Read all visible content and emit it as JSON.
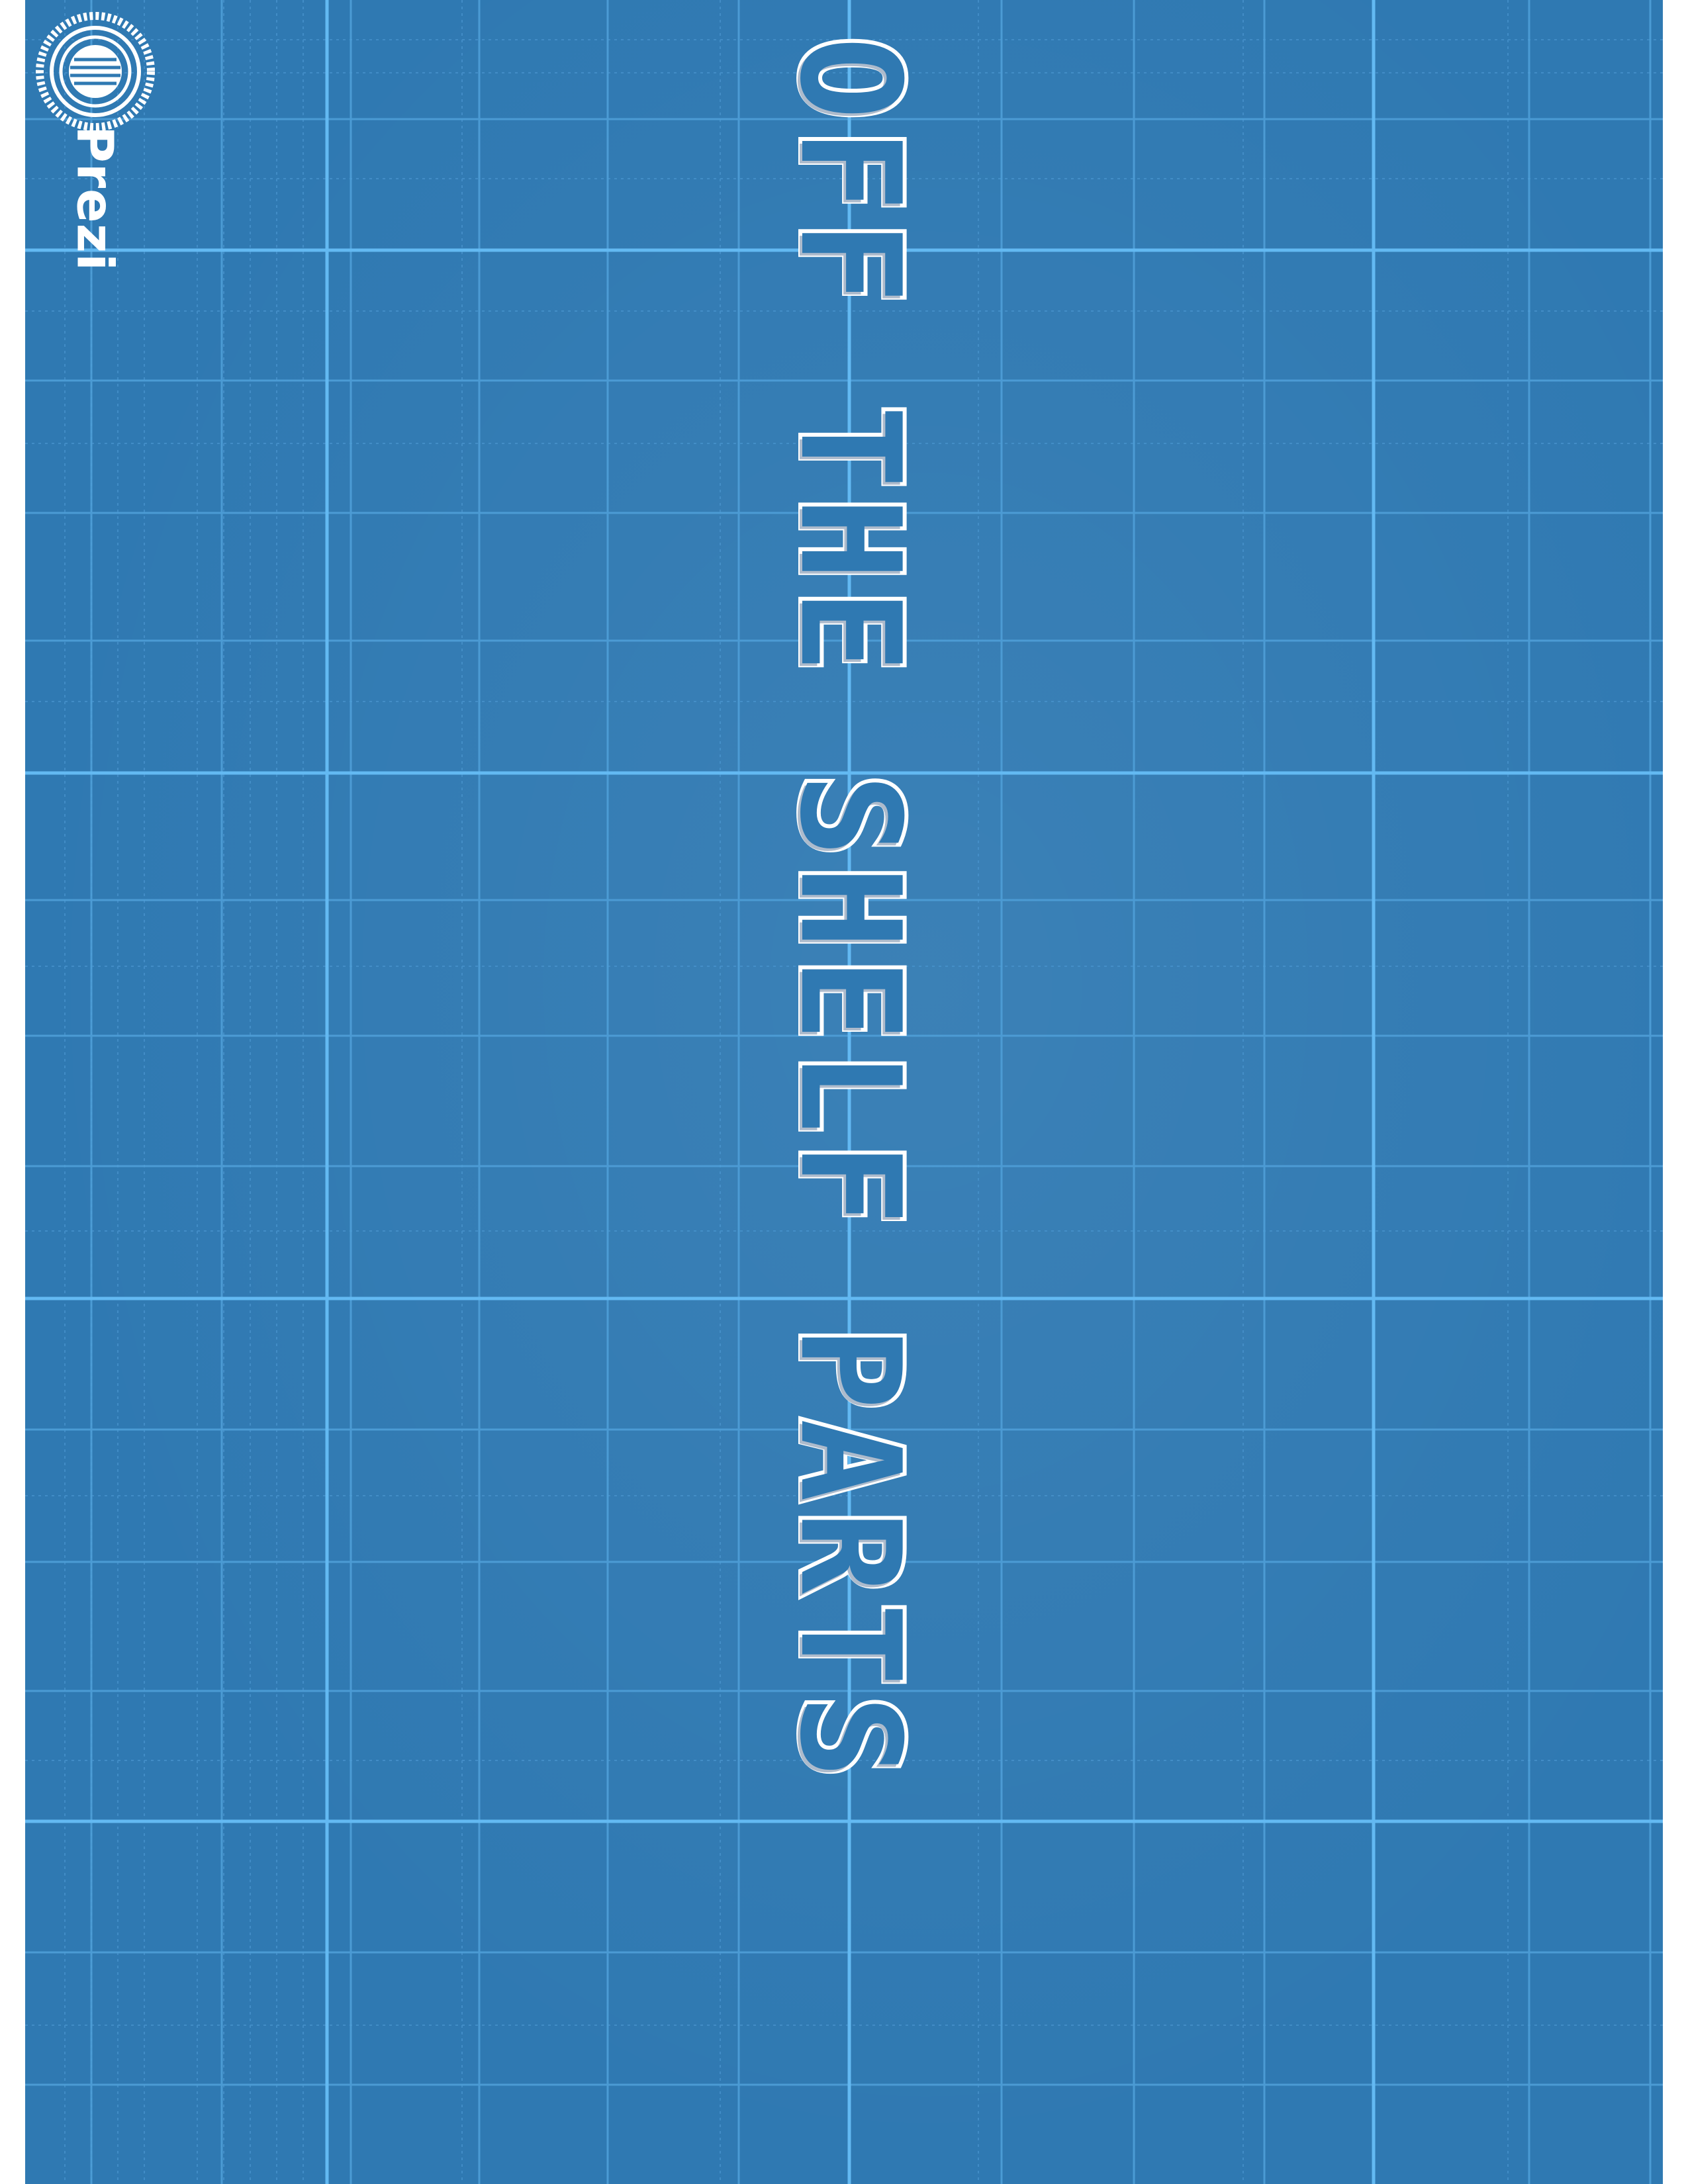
{
  "brand": {
    "name": "Prezi",
    "logo_icon": "prezi-logo-icon"
  },
  "slide": {
    "title": "OFF THE SHELF PARTS"
  },
  "theme": {
    "background": "#2f79b2",
    "grid_major": "#63b9f2",
    "grid_minor": "#4f9fd8",
    "text": "#ffffff"
  }
}
